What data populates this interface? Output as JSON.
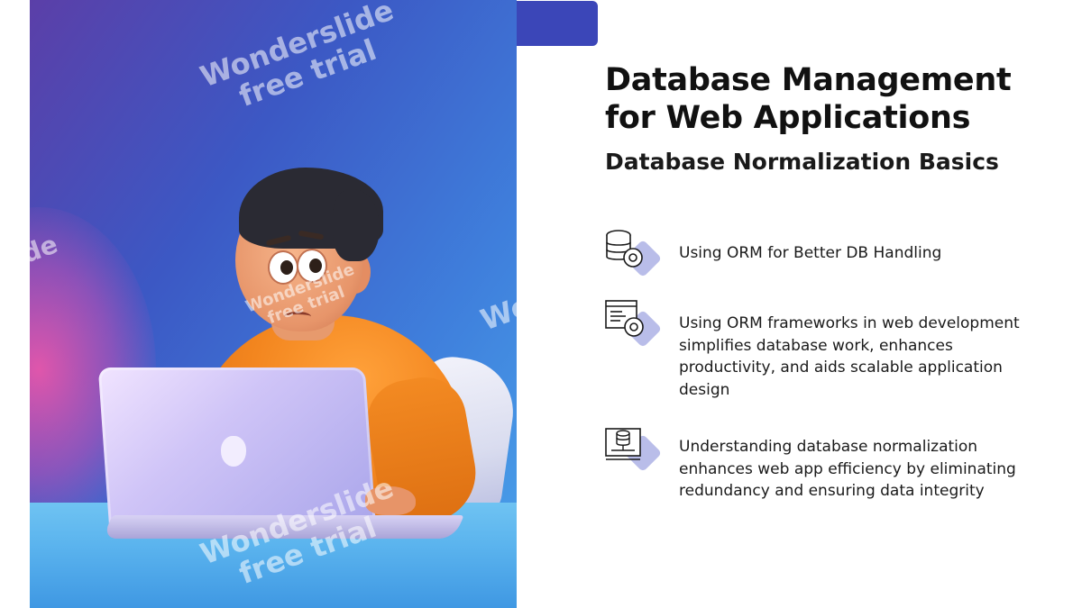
{
  "slide": {
    "title": "Database Management for Web Applications",
    "subtitle": "Database Normalization Basics",
    "accent_color": "#3b46b8",
    "items": [
      {
        "icon": "database-settings-icon",
        "text": "Using ORM for Better DB Handling"
      },
      {
        "icon": "document-gear-icon",
        "text": "Using ORM frameworks in web development simplifies database work, enhances productivity, and aids scalable application design"
      },
      {
        "icon": "database-monitor-icon",
        "text": "Understanding database normalization enhances web app efficiency by eliminating redundancy and ensuring data integrity"
      }
    ]
  },
  "watermark": {
    "line1": "Wonderslide",
    "line2": "free trial",
    "edge_left": "de",
    "edge_right": "Wo"
  },
  "illustration": {
    "subject": "cartoon man in orange sweater looking worried at a laptop",
    "colors": {
      "background_top": "#5b3fa8",
      "background_bottom": "#4aa3ea",
      "sweater": "#f3861f"
    }
  }
}
